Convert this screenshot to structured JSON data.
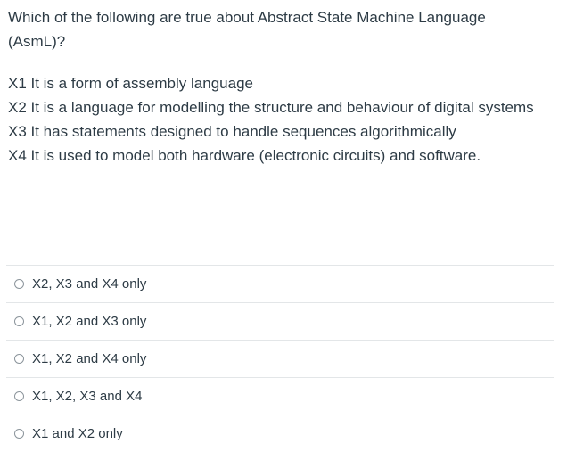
{
  "question": {
    "stem": "Which of the following are true about Abstract State Machine Language (AsmL)?",
    "statements": [
      "X1 It is a form of assembly language",
      "X2 It is a language for modelling the structure and behaviour of digital systems",
      "X3 It has statements designed to handle sequences algorithmically",
      "X4 It is used to model both hardware (electronic circuits) and software."
    ]
  },
  "answers": [
    {
      "label": "X2, X3 and X4 only"
    },
    {
      "label": "X1, X2 and X3 only"
    },
    {
      "label": "X1, X2 and X4 only"
    },
    {
      "label": "X1, X2, X3 and X4"
    },
    {
      "label": "X1 and X2 only"
    }
  ]
}
